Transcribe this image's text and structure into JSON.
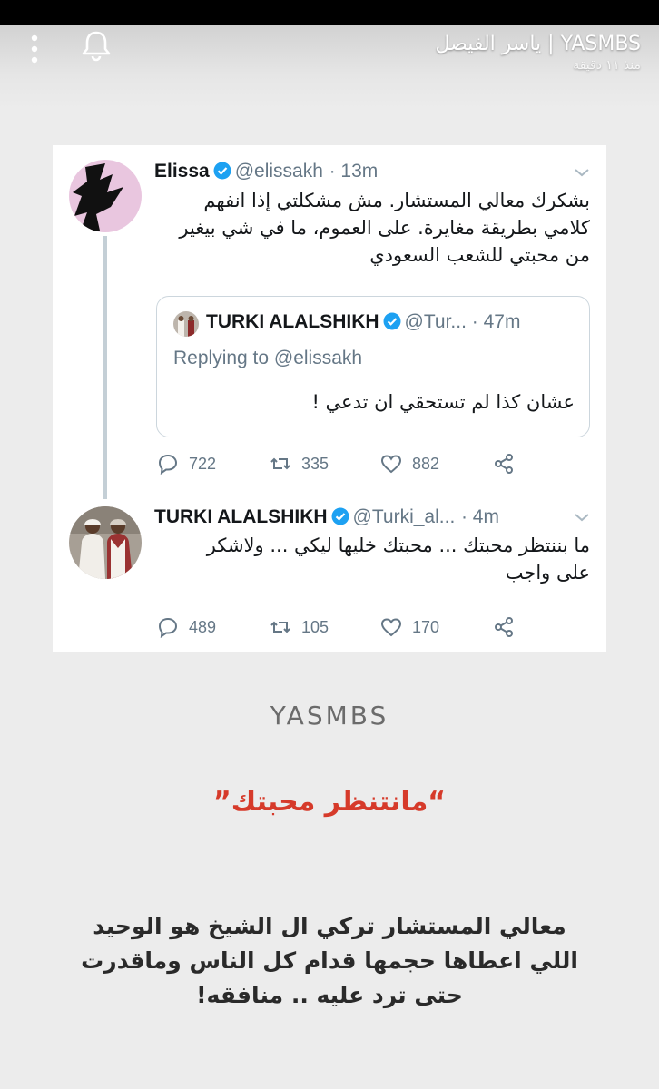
{
  "header": {
    "title": "YASMBS | ياسر الفيصل",
    "time_ago": "منذ ١١ دقيقة",
    "menu_icon": "kebab-menu-icon",
    "bell_icon": "bell-icon"
  },
  "tweet1": {
    "name": "Elissa",
    "handle": "@elissakh",
    "time": "· 13m",
    "text_lines": [
      "بشكرك معالي المستشار. مش مشكلتي إذا انفهم",
      "كلامي بطريقة مغايرة. على العموم، ما في شي بيغير",
      "من محبتي للشعب السعودي"
    ],
    "quoted": {
      "name": "TURKI ALALSHIKH",
      "handle": "@Tur...",
      "time": "· 47m",
      "replying_to": "Replying to @elissakh",
      "text": "عشان كذا لم تستحقي ان تدعي !"
    },
    "actions": {
      "replies": "722",
      "retweets": "335",
      "likes": "882"
    }
  },
  "tweet2": {
    "name": "TURKI ALALSHIKH",
    "handle": "@Turki_al...",
    "time": "· 4m",
    "text_lines": [
      "ما بننتظر محبتك ... محبتك خليها ليكي ... ولاشكر",
      "على واجب"
    ],
    "actions": {
      "replies": "489",
      "retweets": "105",
      "likes": "170"
    }
  },
  "watermark": "YASMBS",
  "caption": "“مانتنظر محبتك”",
  "body_lines": [
    "معالي المستشار تركي ال الشيخ هو الوحيد",
    "اللي اعطاها حجمها قدام كل الناس وماقدرت",
    "حتى ترد عليه .. منافقه!"
  ],
  "colors": {
    "verified": "#1da1f2",
    "caption_red": "#d63a2a",
    "muted": "#657786"
  }
}
